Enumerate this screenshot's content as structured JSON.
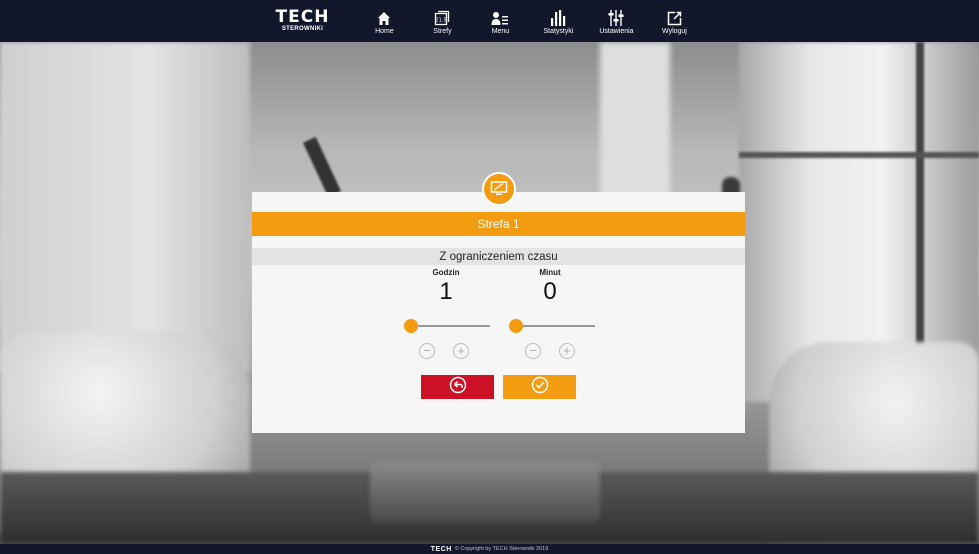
{
  "brand": {
    "logo_word": "TECH",
    "logo_sub": "STEROWNIKI"
  },
  "nav": {
    "items": [
      {
        "label": "Home",
        "icon": "home-icon"
      },
      {
        "label": "Strefy",
        "icon": "zones-icon"
      },
      {
        "label": "Menu",
        "icon": "menu-icon"
      },
      {
        "label": "Statystyki",
        "icon": "statistics-icon"
      },
      {
        "label": "Ustawienia",
        "icon": "settings-icon"
      },
      {
        "label": "Wyloguj",
        "icon": "logout-icon"
      }
    ]
  },
  "dialog": {
    "badge_icon": "monitor-icon",
    "title": "Strefa 1",
    "subtitle": "Z ograniczeniem czasu",
    "hours": {
      "caption": "Godzin",
      "value": "1",
      "slider_fraction": 0.0
    },
    "minutes": {
      "caption": "Minut",
      "value": "0",
      "slider_fraction": 0.0
    },
    "buttons": {
      "back_icon": "undo-icon",
      "confirm_icon": "check-icon"
    }
  },
  "footer": {
    "logo": "TECH",
    "text": "© Copyright by TECH Sterowniki 2019"
  },
  "colors": {
    "accent": "#f39c12",
    "danger": "#cc1126",
    "navbar": "#12172b"
  }
}
